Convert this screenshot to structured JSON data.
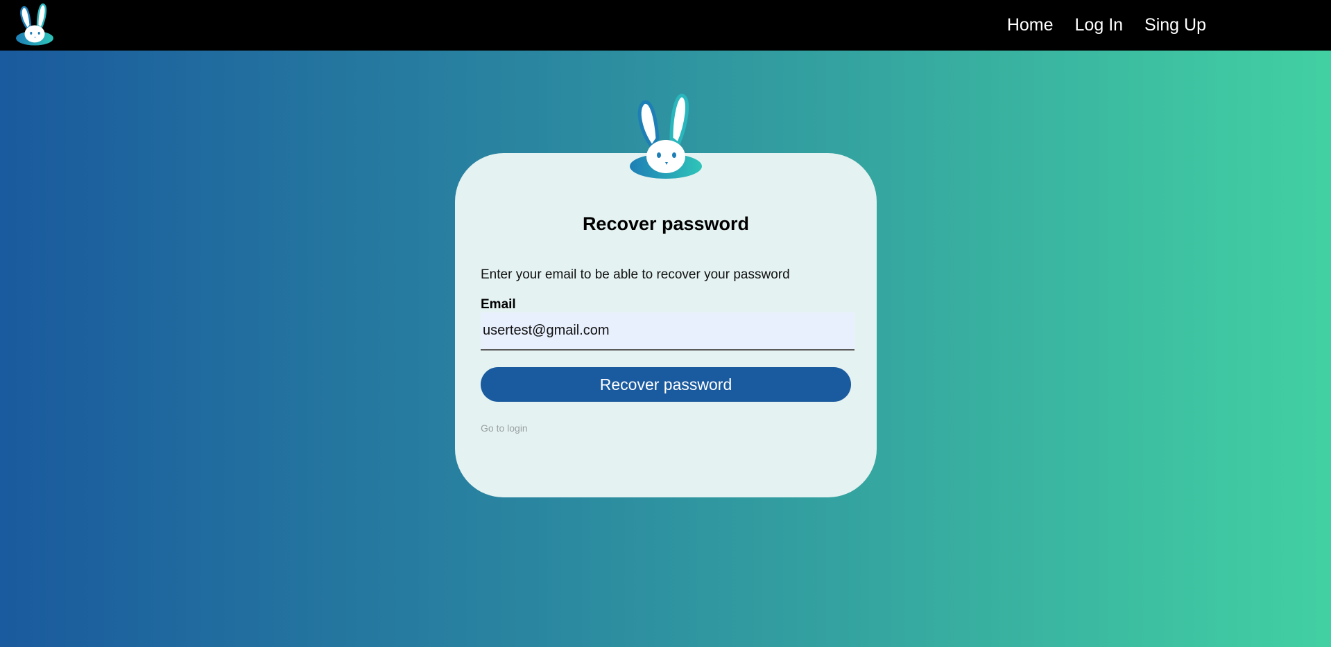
{
  "navbar": {
    "logo_icon": "bunny-logo-icon",
    "links": [
      {
        "label": "Home"
      },
      {
        "label": "Log In"
      },
      {
        "label": "Sing Up"
      }
    ]
  },
  "card": {
    "logo_icon": "bunny-logo-icon",
    "title": "Recover password",
    "description": "Enter your email to be able to recover your password",
    "email_label": "Email",
    "email_value": "usertest@gmail.com",
    "button_label": "Recover password",
    "login_link": "Go to login"
  },
  "colors": {
    "navbar_bg": "#000000",
    "gradient_start": "#1a5a9e",
    "gradient_end": "#42d0a2",
    "card_bg": "#e4f2f1",
    "button_bg": "#1a5a9e",
    "input_bg": "#e8f0fe",
    "link_color": "#9aa0a3"
  }
}
